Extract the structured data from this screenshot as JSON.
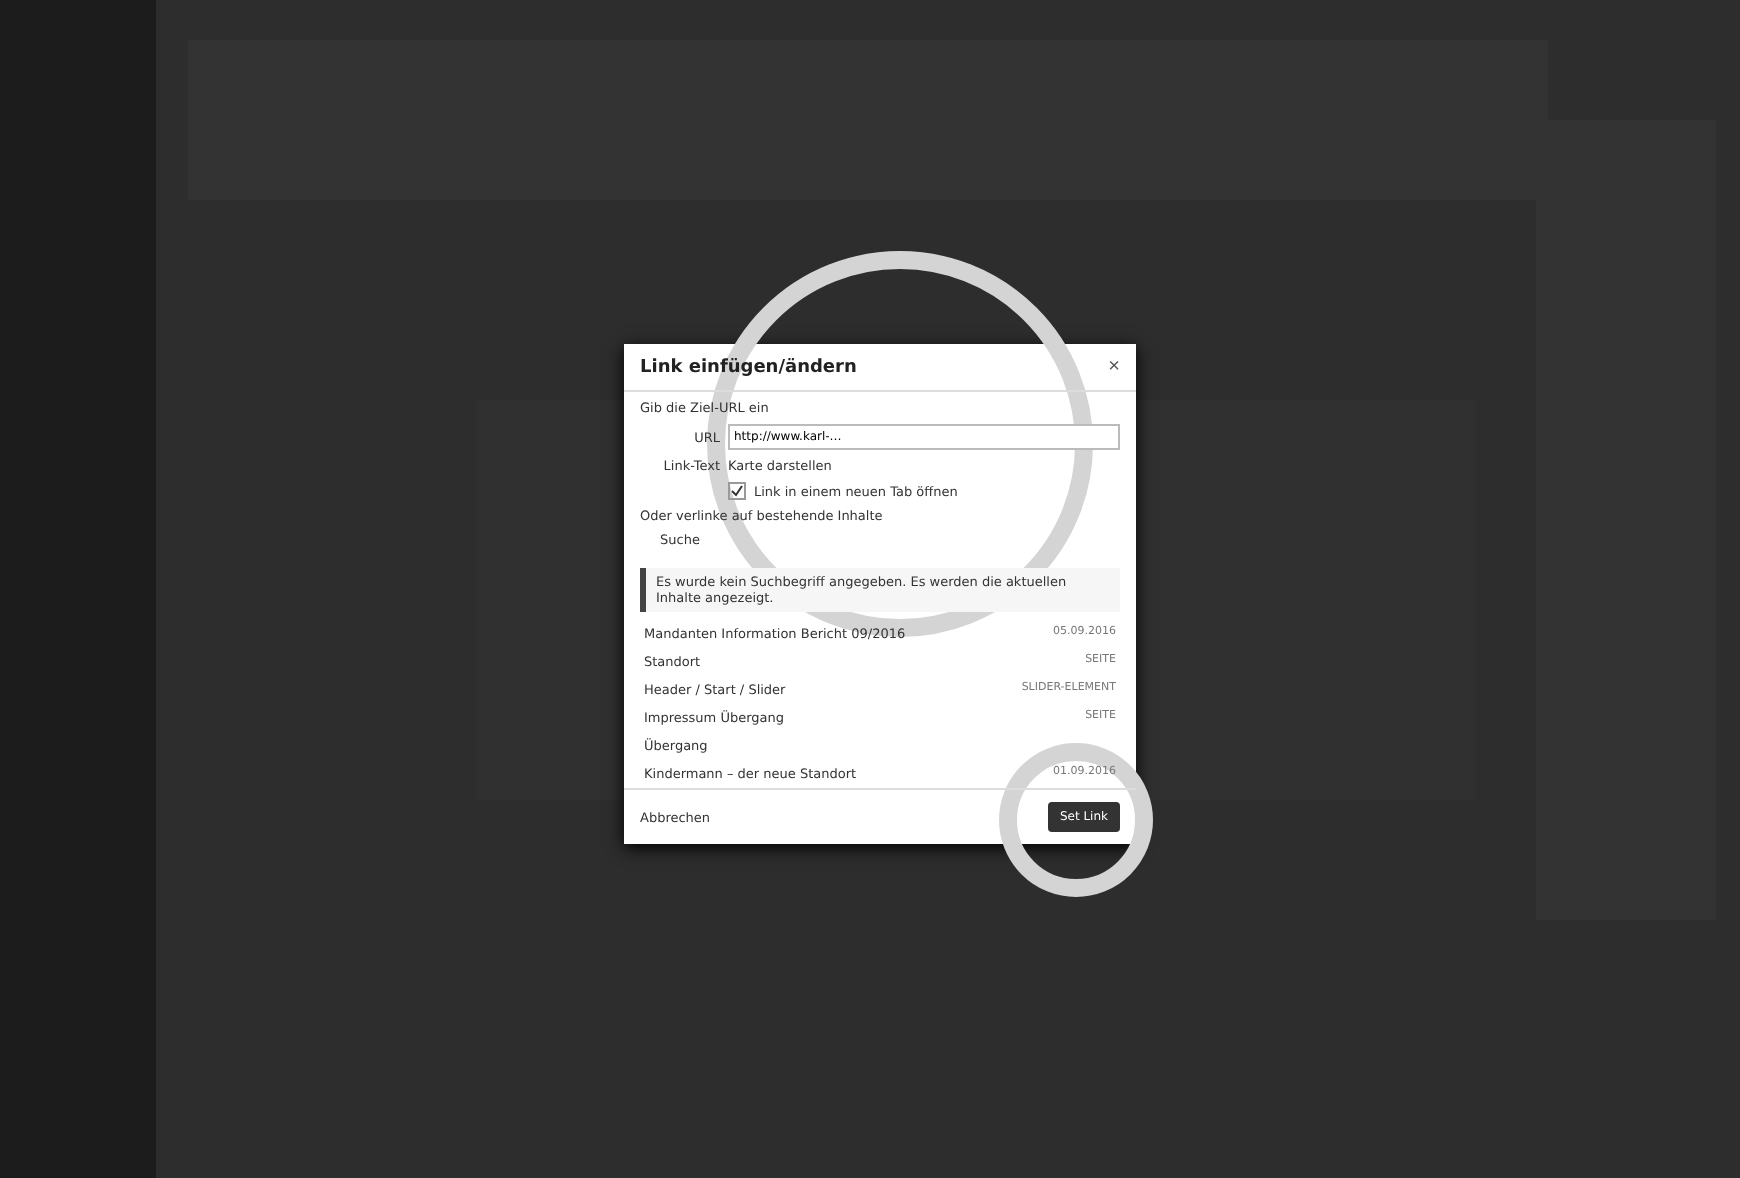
{
  "dialog": {
    "title": "Link einfügen/ändern",
    "close": "×",
    "intro": "Gib die Ziel-URL ein",
    "url": {
      "label": "URL",
      "value": "http://www.karl-…"
    },
    "link_text": {
      "label": "Link-Text",
      "value": "Karte darstellen"
    },
    "new_tab": {
      "label": "Link in einem neuen Tab öffnen",
      "checked": true
    },
    "existing_hint": "Oder verlinke auf bestehende Inhalte",
    "search": {
      "label": "Suche"
    },
    "notice": "Es wurde kein Suchbegriff angegeben. Es werden die aktuellen Inhalte angezeigt.",
    "results": [
      {
        "title": "Mandanten Information Bericht 09/2016",
        "meta": "05.09.2016"
      },
      {
        "title": "Standort",
        "meta": "SEITE"
      },
      {
        "title": "Header / Start / Slider",
        "meta": "SLIDER-ELEMENT"
      },
      {
        "title": "Impressum Übergang",
        "meta": "SEITE"
      },
      {
        "title": "Übergang"
      },
      {
        "title": "Kindermann – der neue Standort",
        "meta": "01.09.2016"
      }
    ],
    "cancel": "Abbrechen",
    "submit": "Set Link"
  }
}
